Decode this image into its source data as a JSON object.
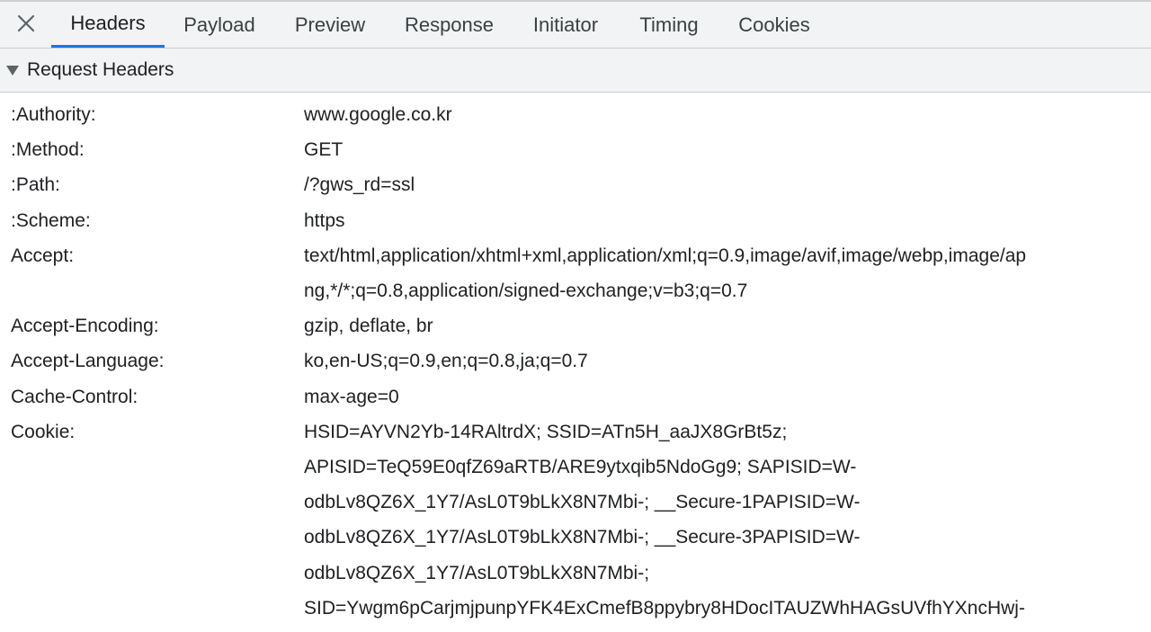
{
  "tabs": {
    "headers": "Headers",
    "payload": "Payload",
    "preview": "Preview",
    "response": "Response",
    "initiator": "Initiator",
    "timing": "Timing",
    "cookies": "Cookies",
    "active": "Headers"
  },
  "icons": {
    "close": "close-icon",
    "section_toggle": "triangle-down-icon"
  },
  "section": {
    "title": "Request Headers"
  },
  "headers": [
    {
      "name": ":Authority:",
      "value": "www.google.co.kr"
    },
    {
      "name": ":Method:",
      "value": "GET"
    },
    {
      "name": ":Path:",
      "value": "/?gws_rd=ssl"
    },
    {
      "name": ":Scheme:",
      "value": "https"
    },
    {
      "name": "Accept:",
      "value_lines": [
        "text/html,application/xhtml+xml,application/xml;q=0.9,image/avif,image/webp,image/ap",
        "ng,*/*;q=0.8,application/signed-exchange;v=b3;q=0.7"
      ]
    },
    {
      "name": "Accept-Encoding:",
      "value": "gzip, deflate, br"
    },
    {
      "name": "Accept-Language:",
      "value": "ko,en-US;q=0.9,en;q=0.8,ja;q=0.7"
    },
    {
      "name": "Cache-Control:",
      "value": "max-age=0"
    },
    {
      "name": "Cookie:",
      "value_lines": [
        "HSID=AYVN2Yb-14RAltrdX; SSID=ATn5H_aaJX8GrBt5z;",
        "APISID=TeQ59E0qfZ69aRTB/ARE9ytxqib5NdoGg9; SAPISID=W-",
        "odbLv8QZ6X_1Y7/AsL0T9bLkX8N7Mbi-; __Secure-1PAPISID=W-",
        "odbLv8QZ6X_1Y7/AsL0T9bLkX8N7Mbi-; __Secure-3PAPISID=W-",
        "odbLv8QZ6X_1Y7/AsL0T9bLkX8N7Mbi-;",
        "SID=Ywgm6pCarjmjpunpYFK4ExCmefB8ppybry8HDocITAUZWhHAGsUVfhYXncHwj-"
      ]
    }
  ],
  "colors": {
    "accent": "#1a73e8",
    "toolbar_bg": "#f1f3f4",
    "text": "#202124"
  }
}
